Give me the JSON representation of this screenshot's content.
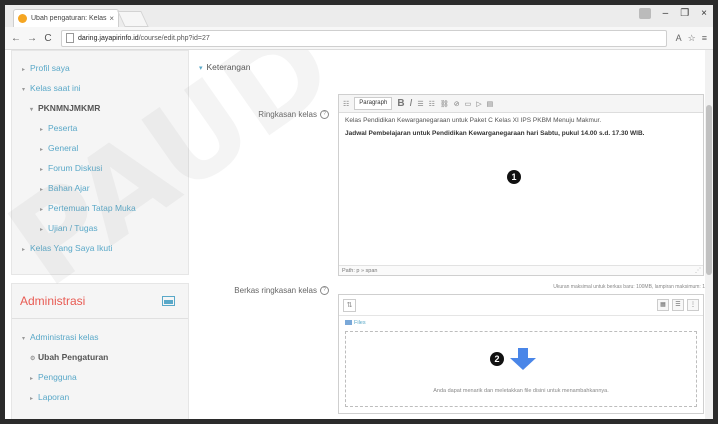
{
  "browser": {
    "tab_title": "Ubah pengaturan: Kelas",
    "tab_close": "×",
    "url_host": "daring.jayapirinfo.id",
    "url_path": "/course/edit.php?id=27",
    "nav_back": "←",
    "nav_forward": "→",
    "nav_reload": "C",
    "window_minimize": "–",
    "window_maximize": "❐",
    "window_close": "×",
    "translate_icon_label": "A",
    "star_icon_label": "☆",
    "menu_icon_label": "≡"
  },
  "sidebar": {
    "nav": [
      {
        "label": "Profil saya",
        "arrow": "▸"
      },
      {
        "label": "Kelas saat ini",
        "arrow": "▾"
      },
      {
        "label": "PKNMNJMKMR",
        "arrow": "▾"
      },
      {
        "label": "Peserta",
        "arrow": "▸"
      },
      {
        "label": "General",
        "arrow": "▸"
      },
      {
        "label": "Forum Diskusi",
        "arrow": "▸"
      },
      {
        "label": "Bahan Ajar",
        "arrow": "▸"
      },
      {
        "label": "Pertemuan Tatap Muka",
        "arrow": "▸"
      },
      {
        "label": "Ujian / Tugas",
        "arrow": "▸"
      },
      {
        "label": "Kelas Yang Saya Ikuti",
        "arrow": "▸"
      }
    ],
    "admin_title": "Administrasi",
    "admin_items": [
      {
        "label": "Administrasi kelas",
        "arrow": "▾"
      },
      {
        "label": "Ubah Pengaturan",
        "arrow": "⚙"
      },
      {
        "label": "Pengguna",
        "arrow": "▸"
      },
      {
        "label": "Laporan",
        "arrow": "▸"
      }
    ]
  },
  "main": {
    "section_title": "Keterangan",
    "section_arrow": "▾",
    "summary_label": "Ringkasan kelas",
    "help_icon": "?",
    "editor_toolbar": {
      "format_select": "Paragraph",
      "bold": "B",
      "italic": "I"
    },
    "editor_lines": [
      "Kelas Pendidikan Kewarganegaraan untuk Paket C Kelas XI IPS PKBM Menuju Makmur.",
      "Jadwal Pembelajaran untuk Pendidikan Kewarganegaraan hari Sabtu, pukul 14.00 s.d. 17.30 WIB."
    ],
    "editor_path": "Path: p » span",
    "callout_1": "1",
    "files_label": "Berkas ringkasan kelas",
    "file_limits": "Ukuran maksimal untuk berkas baru: 100MB, lampiran maksimum: 1",
    "folder_label": "Files",
    "callout_2": "2",
    "drop_text": "Anda dapat menarik dan meletakkan file disini untuk menambahkannya."
  },
  "watermark_text": "PAUD & DIKMAS",
  "colors": {
    "link": "#59a8c8",
    "admin_title": "#e85b53",
    "drop_arrow": "#4a86e8"
  }
}
